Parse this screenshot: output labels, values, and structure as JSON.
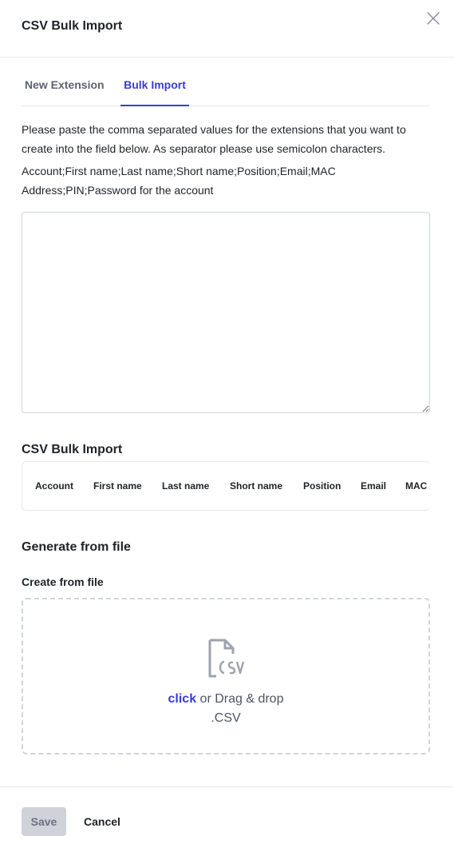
{
  "dialog": {
    "title": "CSV Bulk Import",
    "close_icon": "close-icon"
  },
  "tabs": [
    {
      "label": "New Extension",
      "active": false
    },
    {
      "label": "Bulk Import",
      "active": true
    }
  ],
  "instructions": {
    "description": "Please paste the comma separated values for the extensions that you want to create into the field below. As separator please use semicolon characters.",
    "fields": "Account;First name;Last name;Short name;Position;Email;MAC Address;PIN;Password for the account"
  },
  "csv_input": {
    "value": "",
    "placeholder": ""
  },
  "preview": {
    "title": "CSV Bulk Import",
    "columns": [
      "Account",
      "First name",
      "Last name",
      "Short name",
      "Position",
      "Email",
      "MAC Address"
    ]
  },
  "generate": {
    "title": "Generate from file",
    "label": "Create from file",
    "icon": "csv-file-icon",
    "click_text": "click",
    "drag_text": " or Drag & drop",
    "extension": ".CSV"
  },
  "footer": {
    "save_label": "Save",
    "cancel_label": "Cancel"
  },
  "colors": {
    "accent": "#3b3bd6",
    "border": "#e5e7eb",
    "disabled_button": "#cfd2d8"
  }
}
